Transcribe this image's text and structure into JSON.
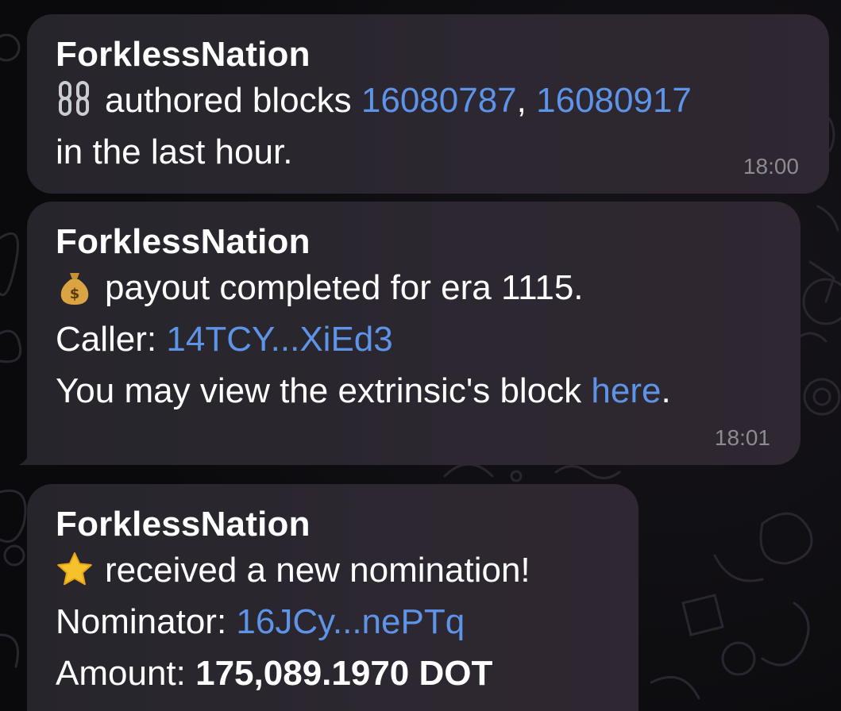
{
  "messages": [
    {
      "sender": "ForklessNation",
      "icon": "chain-icon",
      "text1": "authored blocks",
      "block1": "16080787",
      "sep": ",",
      "block2": "16080917",
      "text2": "in the last hour.",
      "time": "18:00"
    },
    {
      "sender": "ForklessNation",
      "icon": "money-bag-icon",
      "text1": "payout completed for era 1115.",
      "caller_label": "Caller:",
      "caller": "14TCY...XiEd3",
      "view_text": "You may view the extrinsic's block",
      "view_link": "here",
      "view_end": ".",
      "time": "18:01"
    },
    {
      "sender": "ForklessNation",
      "icon": "star-icon",
      "text1": "received a new nomination!",
      "nominator_label": "Nominator:",
      "nominator": "16JCy...nePTq",
      "amount_label": "Amount:",
      "amount": "175,089.1970 DOT"
    }
  ],
  "colors": {
    "bubble": "#2a262e",
    "link": "#5e94e8",
    "text": "#ffffff",
    "time": "#8c8a92",
    "background": "#0d0d10"
  }
}
